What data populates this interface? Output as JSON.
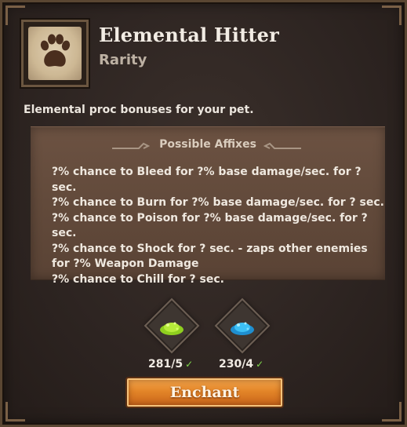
{
  "item": {
    "title": "Elemental Hitter",
    "subtitle": "Rarity",
    "icon": "paw-print-icon",
    "description": "Elemental proc bonuses for your pet."
  },
  "affixes": {
    "header": "Possible Affixes",
    "lines": [
      "?% chance to Bleed for ?% base damage/sec. for ? sec.",
      "?% chance to Burn for ?% base damage/sec. for ? sec.",
      "?% chance to Poison for ?% base damage/sec. for ? sec.",
      "?% chance to Shock for ? sec. - zaps other enemies for ?% Weapon Damage",
      "?% chance to Chill for ? sec."
    ]
  },
  "materials": [
    {
      "icon": "green-dust-icon",
      "count": "281/5",
      "color": "#a6e12a"
    },
    {
      "icon": "blue-dust-icon",
      "count": "230/4",
      "color": "#37b8f0"
    }
  ],
  "enchant_button": {
    "label": "Enchant"
  },
  "colors": {
    "accent": "#e38528",
    "check": "#7fd84c"
  }
}
